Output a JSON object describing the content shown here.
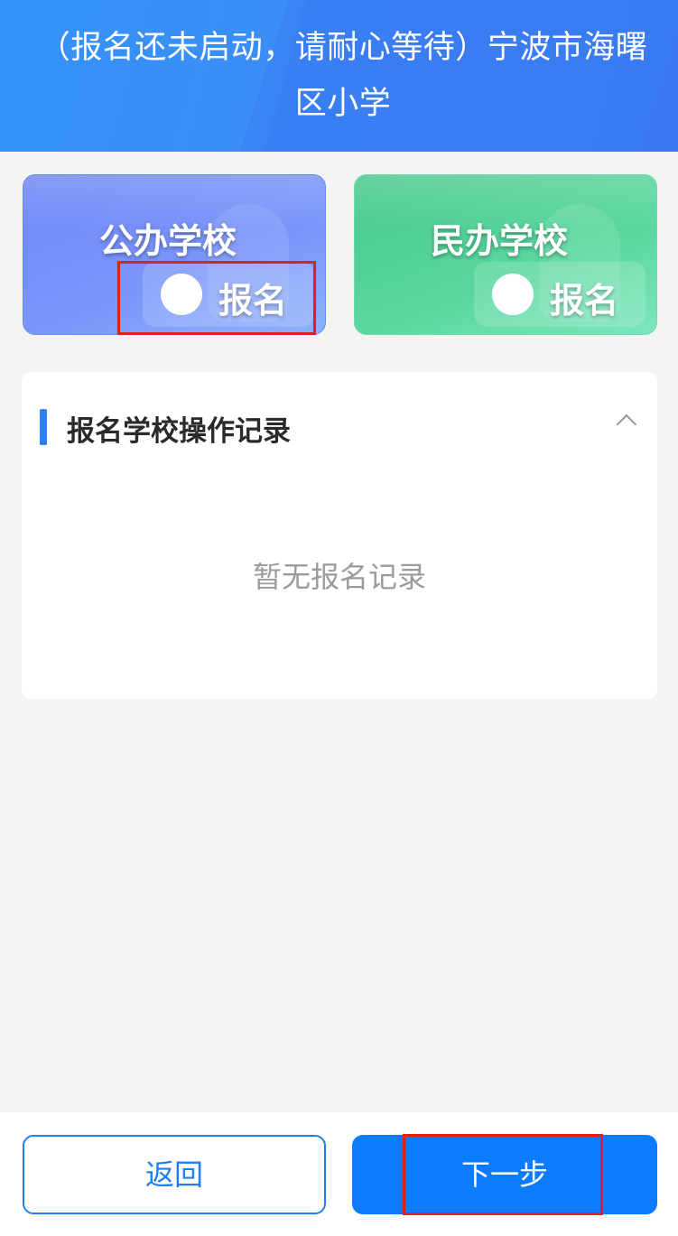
{
  "header": {
    "title": "（报名还未启动，请耐心等待）宁波市海曙区小学"
  },
  "cards": [
    {
      "title": "公办学校",
      "action_label": "报名",
      "color": "#7b97fb"
    },
    {
      "title": "民办学校",
      "action_label": "报名",
      "color": "#5ad7a0"
    }
  ],
  "records": {
    "title": "报名学校操作记录",
    "empty_text": "暂无报名记录",
    "toggle_icon": "chevron-up-icon"
  },
  "footer": {
    "back_label": "返回",
    "next_label": "下一步"
  },
  "colors": {
    "primary": "#0b7cff",
    "highlight": "#e02020"
  }
}
